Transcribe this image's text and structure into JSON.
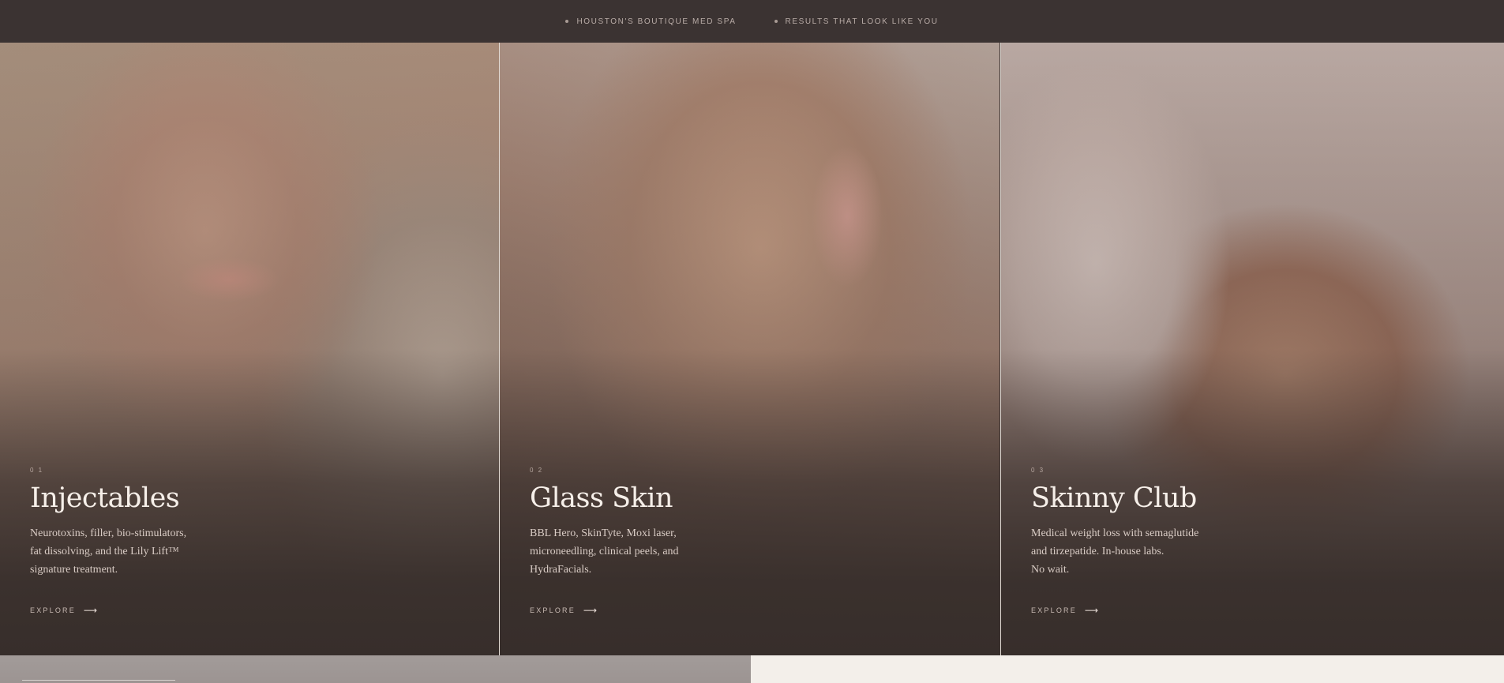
{
  "topbar": {
    "items": [
      {
        "label": "HOUSTON'S BOUTIQUE MED SPA"
      },
      {
        "label": "RESULTS THAT LOOK LIKE YOU"
      }
    ]
  },
  "services": [
    {
      "number": "0 1",
      "title": "Injectables",
      "description": "Neurotoxins, filler, bio-stimulators,\nfat dissolving, and the Lily Lift™\nsignature treatment.",
      "cta": "EXPLORE",
      "cta_icon": "arrow-right-icon"
    },
    {
      "number": "0 2",
      "title": "Glass Skin",
      "description": "BBL Hero, SkinTyte, Moxi laser,\nmicroneedling, clinical peels, and\nHydraFacials.",
      "cta": "EXPLORE",
      "cta_icon": "arrow-right-icon"
    },
    {
      "number": "0 3",
      "title": "Skinny Club",
      "description": "Medical weight loss with semaglutide\nand tirzepatide. In-house labs.\nNo wait.",
      "cta": "EXPLORE",
      "cta_icon": "arrow-right-icon"
    }
  ],
  "colors": {
    "topbar_bg": "#3b3332",
    "overlay_dark": "#372e2b",
    "title_text": "#f6efe9",
    "cream_section": "#f3efea"
  }
}
